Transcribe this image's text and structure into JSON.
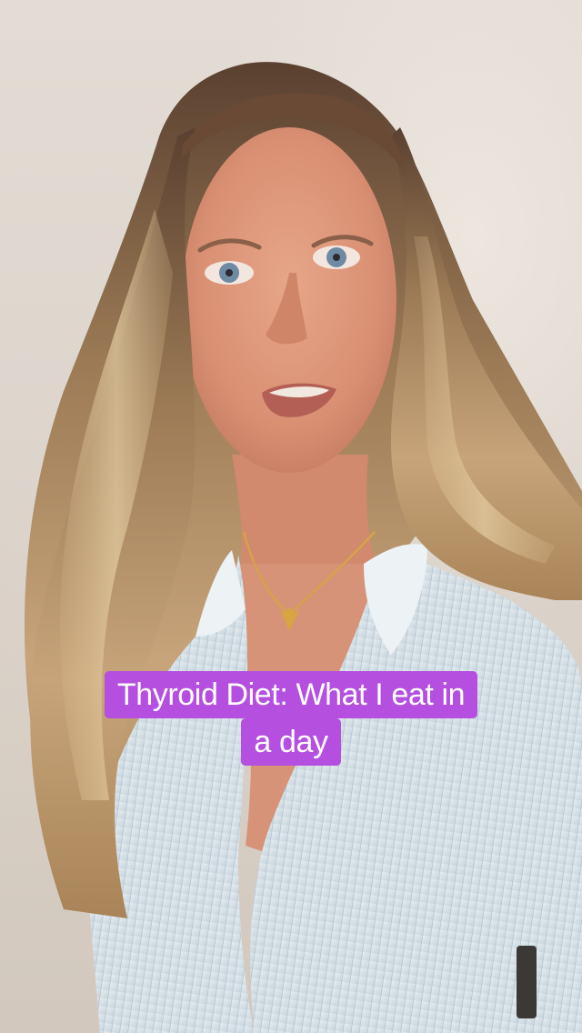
{
  "caption": {
    "line1": "Thyroid Diet: What I eat in",
    "line2": "a day"
  },
  "colors": {
    "caption_background": "#b54fe0",
    "caption_text": "#ffffff",
    "wall": "#e3dcd4"
  },
  "icons": {
    "scene": "woman-speaking-to-camera"
  }
}
